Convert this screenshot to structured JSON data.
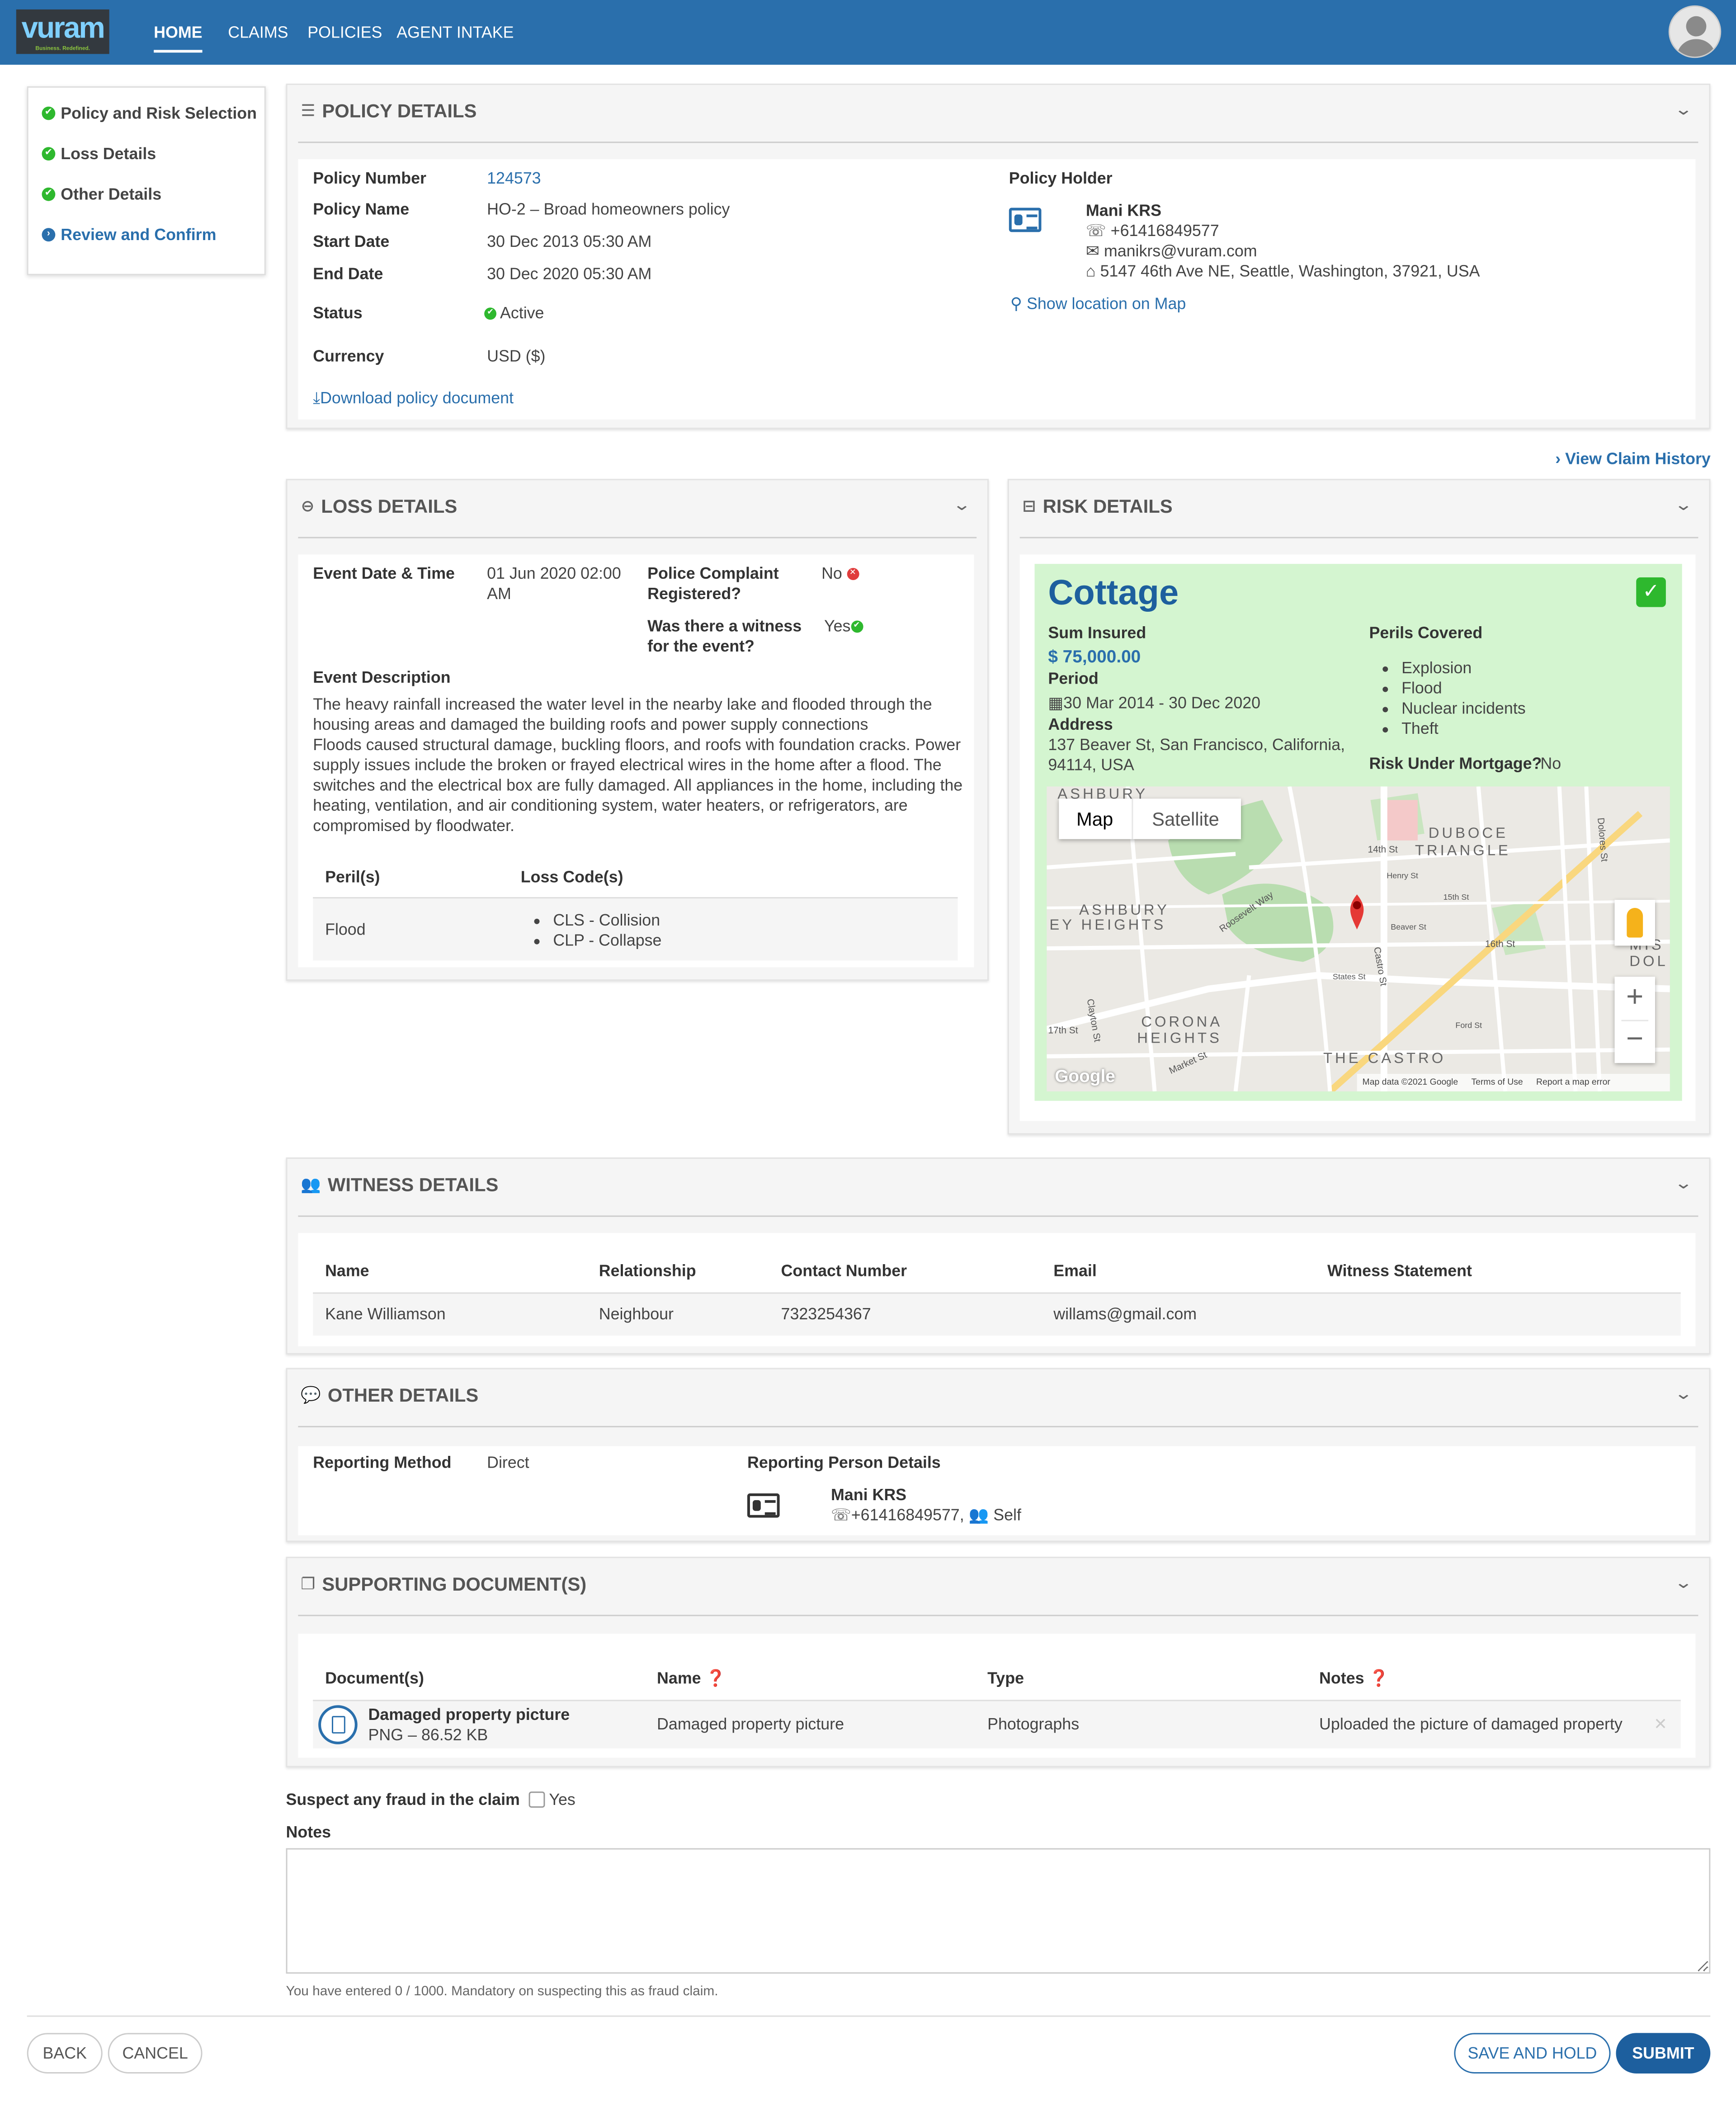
{
  "app": {
    "logo": "vuram",
    "logo_tagline": "Business. Redefined."
  },
  "nav": {
    "home": "HOME",
    "claims": "CLAIMS",
    "policies": "POLICIES",
    "agent_intake": "AGENT INTAKE"
  },
  "steps": [
    "Policy and Risk Selection",
    "Loss Details",
    "Other Details",
    "Review and Confirm"
  ],
  "policy": {
    "title": "POLICY DETAILS",
    "number_label": "Policy Number",
    "number": "124573",
    "name_label": "Policy Name",
    "name": "HO-2 – Broad homeowners policy",
    "start_label": "Start Date",
    "start": "30 Dec 2013 05:30 AM",
    "end_label": "End Date",
    "end": "30 Dec 2020 05:30 AM",
    "status_label": "Status",
    "status": "Active",
    "currency_label": "Currency",
    "currency": "USD ($)",
    "download": "Download policy document",
    "holder_label": "Policy Holder",
    "holder_name": "Mani KRS",
    "holder_phone": "+61416849577",
    "holder_email": "manikrs@vuram.com",
    "holder_address": "5147 46th Ave NE, Seattle, Washington, 37921, USA",
    "map_link": "Show location on Map"
  },
  "view_claim_history": "View Claim History",
  "loss": {
    "title": "LOSS DETAILS",
    "event_label": "Event Date & Time",
    "event_value": "01 Jun 2020 02:00 AM",
    "police_label": "Police Complaint Registered?",
    "police_value": "No",
    "witness_label": "Was there a witness for the event?",
    "witness_value": "Yes",
    "desc_label": "Event Description",
    "desc_lines": [
      "The heavy rainfall increased the water level in the nearby lake and flooded through the",
      "housing areas and damaged the building roofs and power supply connections",
      "Floods caused structural damage, buckling floors, and roofs with foundation cracks. Power",
      "supply issues include the broken or frayed electrical wires in the home after a flood. The",
      "switches and the electrical box are fully damaged. All appliances in the home, including the",
      "heating, ventilation, and air conditioning system, water heaters, or refrigerators, are",
      "compromised by floodwater."
    ],
    "peril_header": "Peril(s)",
    "code_header": "Loss Code(s)",
    "peril": "Flood",
    "codes": [
      "CLS - Collision",
      "CLP - Collapse"
    ]
  },
  "risk": {
    "title": "RISK DETAILS",
    "name": "Cottage",
    "sum_label": "Sum Insured",
    "sum": "$ 75,000.00",
    "period_label": "Period",
    "period": "30 Mar 2014 - 30 Dec 2020",
    "address_label": "Address",
    "address_1": "137 Beaver St, San Francisco, California,",
    "address_2": "94114, USA",
    "perils_label": "Perils Covered",
    "perils": [
      "Explosion",
      "Flood",
      "Nuclear incidents",
      "Theft"
    ],
    "mortgage_label": "Risk Under Mortgage?",
    "mortgage": "No"
  },
  "map": {
    "tab_map": "Map",
    "tab_satellite": "Satellite",
    "places": [
      "ASHBURY",
      "DUBOCE",
      "TRIANGLE",
      "ASHBURY",
      "EY HEIGHTS",
      "CORONA",
      "HEIGHTS",
      "THE CASTRO",
      "MIS",
      "DOL"
    ],
    "streets": [
      "14th St",
      "Henry St",
      "15th St",
      "Beaver St",
      "16th St",
      "Roosevelt Way",
      "Castro St",
      "States St",
      "17th St",
      "Market St",
      "Clayton St",
      "Dolores St",
      "Ford St"
    ],
    "google": "Google",
    "footer": [
      "Map data ©2021 Google",
      "Terms of Use",
      "Report a map error"
    ]
  },
  "witness": {
    "title": "WITNESS DETAILS",
    "headers": [
      "Name",
      "Relationship",
      "Contact Number",
      "Email",
      "Witness Statement"
    ],
    "rows": [
      [
        "Kane Williamson",
        "Neighbour",
        "7323254367",
        "willams@gmail.com",
        ""
      ]
    ]
  },
  "other": {
    "title": "OTHER DETAILS",
    "method_label": "Reporting Method",
    "method": "Direct",
    "person_label": "Reporting Person Details",
    "person_name": "Mani KRS",
    "person_phone": "+61416849577,",
    "person_rel": "Self"
  },
  "docs": {
    "title": "SUPPORTING DOCUMENT(S)",
    "headers": [
      "Document(s)",
      "Name",
      "Type",
      "Notes"
    ],
    "file_name": "Damaged property picture",
    "file_meta": "PNG – 86.52 KB",
    "name": "Damaged property picture",
    "type": "Photographs",
    "notes": "Uploaded the picture of damaged property"
  },
  "fraud": {
    "label": "Suspect any fraud in the claim",
    "option": "Yes"
  },
  "notes": {
    "label": "Notes",
    "helper": "You have entered 0 / 1000. Mandatory on suspecting this as fraud claim."
  },
  "actions": {
    "back": "BACK",
    "cancel": "CANCEL",
    "save": "SAVE AND HOLD",
    "submit": "SUBMIT"
  }
}
